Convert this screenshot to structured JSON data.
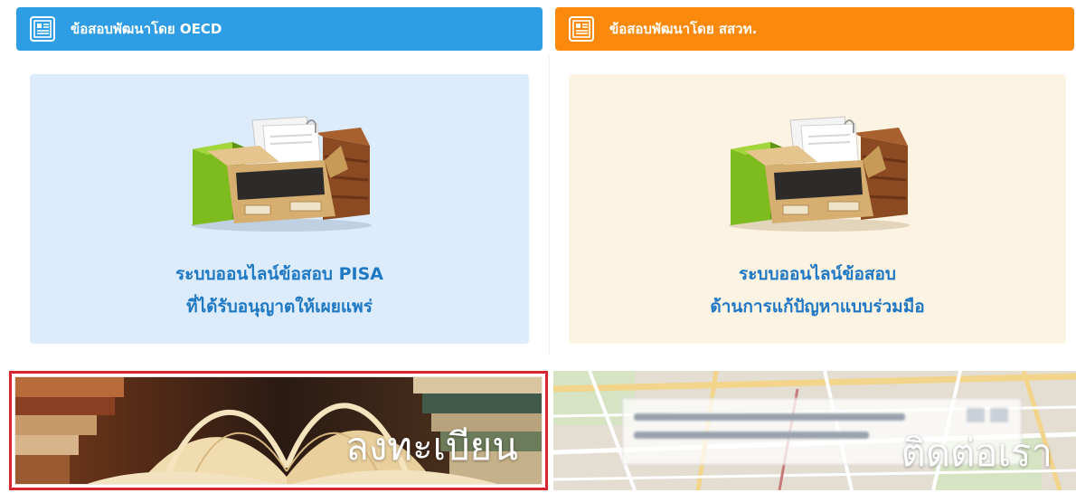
{
  "sections": {
    "oecd": {
      "header_title": "ข้อสอบพัฒนาโดย OECD",
      "header_color": "#2e9de4",
      "panel_color": "#dcecfc",
      "card_title_line1": "ระบบออนไลน์ข้อสอบ PISA",
      "card_title_line2": "ที่ได้รับอนุญาตให้เผยแพร่",
      "card_icon": "archive-box-icon"
    },
    "ipst": {
      "header_title": "ข้อสอบพัฒนาโดย สสวท.",
      "header_color": "#fb8a0c",
      "panel_color": "#fdf3e2",
      "card_title_line1": "ระบบออนไลน์ข้อสอบ",
      "card_title_line2": "ด้านการแก้ปัญหาแบบร่วมมือ",
      "card_icon": "archive-box-icon"
    }
  },
  "banners": {
    "register": {
      "label": "ลงทะเบียน",
      "image": "open-book-image",
      "highlight_color": "#d9252c"
    },
    "contact": {
      "label": "ติดต่อเรา",
      "image": "map-image"
    }
  },
  "icons": {
    "header": "document-list-icon"
  },
  "colors": {
    "link_text": "#1f78c4"
  }
}
